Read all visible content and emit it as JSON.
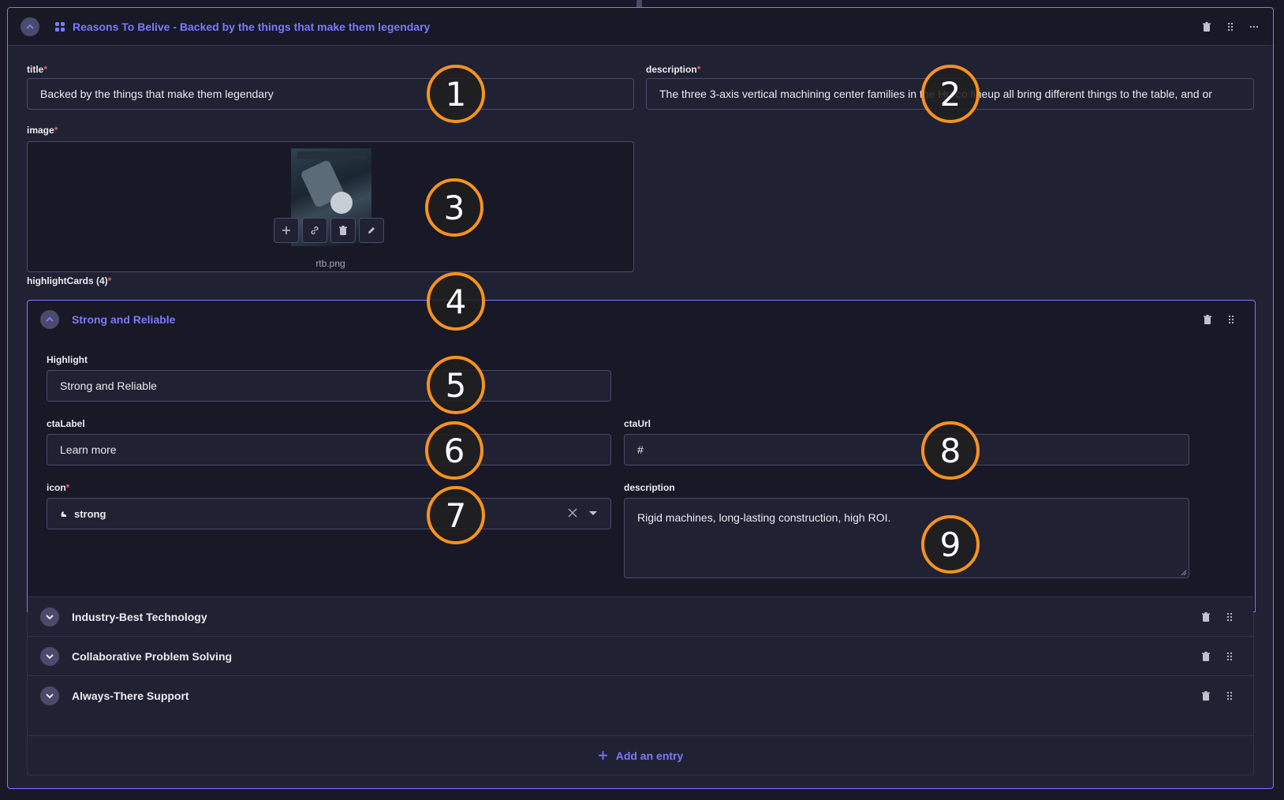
{
  "component": {
    "title": "Reasons To Belive - Backed by the things that make them legendary"
  },
  "fields": {
    "title": {
      "label": "title",
      "value": "Backed by the things that make them legendary"
    },
    "description": {
      "label": "description",
      "value": "The three 3-axis vertical machining center families in the Hurco lineup all bring different things to the table, and or"
    },
    "image": {
      "label": "image",
      "filename": "rtb.png"
    },
    "highlightCards": {
      "label": "highlightCards (4)"
    }
  },
  "required_mark": "*",
  "open_card": {
    "title": "Strong and Reliable",
    "highlight": {
      "label": "Highlight",
      "value": "Strong and Reliable"
    },
    "ctaLabel": {
      "label": "ctaLabel",
      "value": "Learn more"
    },
    "ctaUrl": {
      "label": "ctaUrl",
      "value": "#"
    },
    "icon": {
      "label": "icon",
      "value": "strong"
    },
    "description": {
      "label": "description",
      "value": "Rigid machines, long-lasting construction, high ROI."
    }
  },
  "collapsed_cards": [
    {
      "title": "Industry-Best Technology"
    },
    {
      "title": "Collaborative Problem Solving"
    },
    {
      "title": "Always-There Support"
    }
  ],
  "add_entry_label": "Add an entry",
  "markers": [
    "1",
    "2",
    "3",
    "4",
    "5",
    "6",
    "7",
    "8",
    "9"
  ],
  "colors": {
    "accent": "#7b79ff",
    "required": "#ee5e52",
    "marker": "#f7931e"
  }
}
